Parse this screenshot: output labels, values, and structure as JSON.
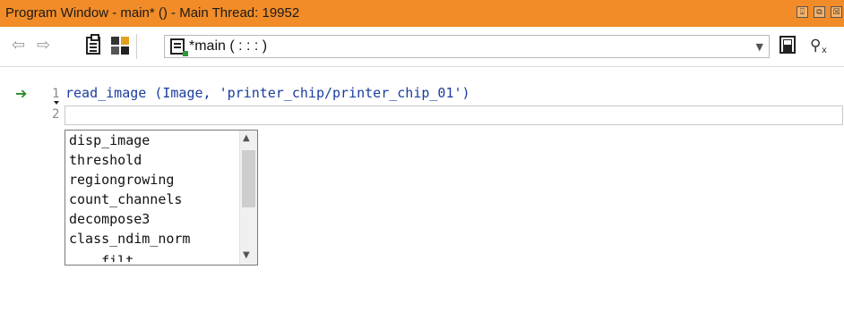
{
  "window": {
    "title": "Program Window - main* () - Main Thread: 19952",
    "buttons": [
      "⍗",
      "⧉",
      "☒"
    ]
  },
  "toolbar": {
    "back_icon": "⇦",
    "forward_icon": "⇨",
    "procedure_label": "*main ( : : : )"
  },
  "editor": {
    "lines": [
      {
        "number": "1",
        "code": "read_image (Image, 'printer_chip/printer_chip_01')"
      },
      {
        "number": "2",
        "code": ""
      }
    ],
    "autocomplete": {
      "items": [
        "disp_image",
        "threshold",
        "regiongrowing",
        "count_channels",
        "decompose3",
        "class_ndim_norm",
        "____filt___"
      ],
      "scroll_position": 0.1
    }
  },
  "colors": {
    "titlebar": "#f28c28",
    "code_text": "#1a3c9e",
    "exec_arrow": "#2a8a2a"
  }
}
